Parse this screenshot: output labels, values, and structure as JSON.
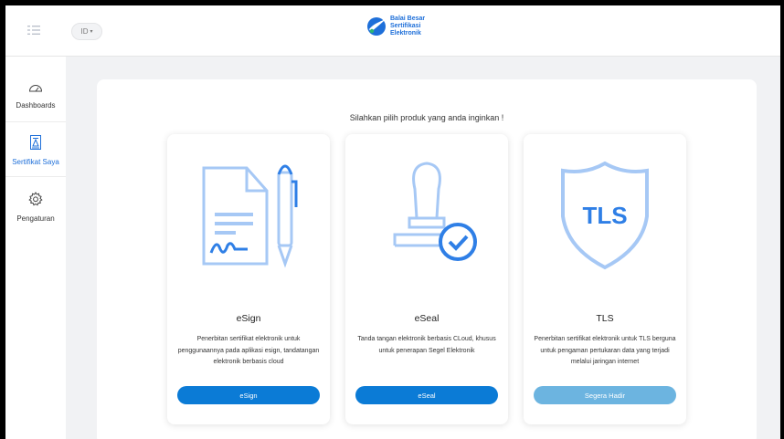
{
  "header": {
    "menu_icon": "list-icon",
    "language": "ID",
    "language_caret": "▾",
    "logo_lines": [
      "Balai Besar",
      "Sertifikasi",
      "Elektronik"
    ]
  },
  "sidebar": {
    "items": [
      {
        "label": "Dashboards",
        "icon": "speedometer-icon",
        "active": false
      },
      {
        "label": "Sertifikat Saya",
        "icon": "certificate-icon",
        "active": true
      },
      {
        "label": "Pengaturan",
        "icon": "gear-icon",
        "active": false
      }
    ]
  },
  "main": {
    "prompt": "Silahkan pilih produk yang anda inginkan !",
    "cards": [
      {
        "title": "eSign",
        "icon": "document-signature-icon",
        "description": "Penerbitan sertifikat elektronik untuk penggunaannya pada aplikasi esign, tandatangan elektronik berbasis cloud",
        "button": "eSign"
      },
      {
        "title": "eSeal",
        "icon": "stamp-check-icon",
        "description": "Tanda tangan elektronik berbasis CLoud, khusus untuk penerapan Segel Elektronik",
        "button": "eSeal"
      },
      {
        "title": "TLS",
        "icon": "tls-shield-icon",
        "shield_text": "TLS",
        "description": "Penerbitan sertifikat elektronik untuk TLS berguna untuk pengaman pertukaran data yang terjadi melalui jaringan internet",
        "button": "Segera Hadir"
      }
    ]
  },
  "colors": {
    "primary": "#0b7bd6",
    "disabled_button": "#6cb4e0",
    "illustration_light": "#a6c8f5",
    "illustration_blue": "#2f7fe6",
    "active_nav": "#1e6fd9"
  }
}
